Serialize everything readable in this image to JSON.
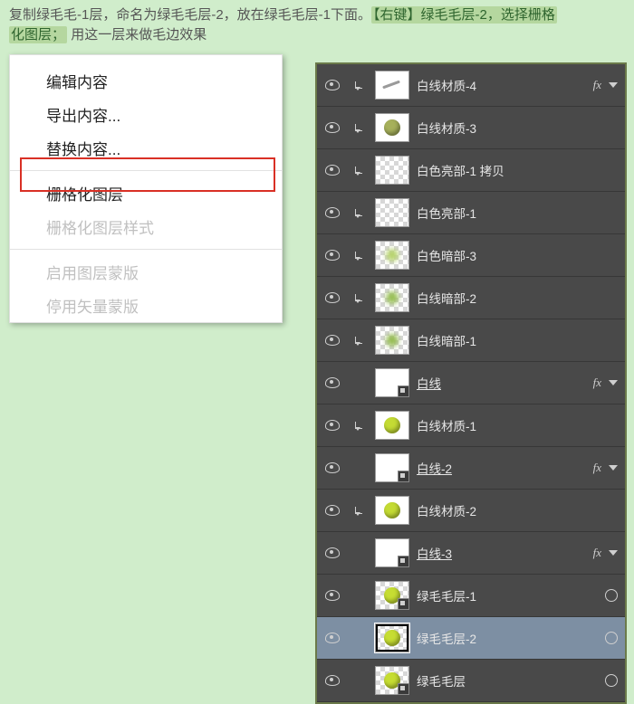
{
  "instruction": {
    "t1": "复制绿毛毛-1层，命名为绿毛毛层-2，放在绿毛毛层-1下面。",
    "t2": "【右键】绿毛毛层-2，选择栅格",
    "t3": "化图层；",
    "t4": "用这一层来做毛边效果"
  },
  "context_menu": {
    "items": [
      {
        "label": "编辑内容",
        "enabled": true
      },
      {
        "label": "导出内容...",
        "enabled": true
      },
      {
        "label": "替换内容...",
        "enabled": true
      },
      {
        "sep": true
      },
      {
        "label": "栅格化图层",
        "enabled": true,
        "highlighted": true
      },
      {
        "label": "栅格化图层样式",
        "enabled": false
      },
      {
        "sep": true
      },
      {
        "label": "启用图层蒙版",
        "enabled": false
      },
      {
        "label": "停用矢量蒙版",
        "enabled": false
      }
    ]
  },
  "layers": [
    {
      "name": "白线材质-4",
      "nested": true,
      "thumb": "white-line",
      "fx": true,
      "chev": true
    },
    {
      "name": "白线材质-3",
      "nested": true,
      "thumb": "ball",
      "ball_color": "#a6b05b"
    },
    {
      "name": "白色亮部-1 拷贝",
      "nested": true,
      "thumb": "checker"
    },
    {
      "name": "白色亮部-1",
      "nested": true,
      "thumb": "checker"
    },
    {
      "name": "白色暗部-3",
      "nested": true,
      "thumb": "blur",
      "blur_color": "#b8d46f"
    },
    {
      "name": "白线暗部-2",
      "nested": true,
      "thumb": "blur",
      "blur_color": "#99c056"
    },
    {
      "name": "白线暗部-1",
      "nested": true,
      "thumb": "blur",
      "blur_color": "#97bd55"
    },
    {
      "name": "白线",
      "nested": false,
      "thumb": "white",
      "smart": true,
      "underline": true,
      "fx": true,
      "chev": true
    },
    {
      "name": "白线材质-1",
      "nested": true,
      "thumb": "ball",
      "ball_color": "#c4db34"
    },
    {
      "name": "白线-2",
      "nested": false,
      "thumb": "white",
      "smart": true,
      "underline": true,
      "fx": true,
      "chev": true
    },
    {
      "name": "白线材质-2",
      "nested": true,
      "thumb": "ball",
      "ball_color": "#c4db34"
    },
    {
      "name": "白线-3",
      "nested": false,
      "thumb": "white",
      "smart": true,
      "underline": true,
      "fx": true,
      "chev": true
    },
    {
      "name": "绿毛毛层-1",
      "nested": false,
      "thumb": "ball",
      "ball_color": "#c6dd32",
      "smart": true,
      "checker_bg": true,
      "circ": true
    },
    {
      "name": "绿毛毛层-2",
      "nested": false,
      "thumb": "ball",
      "ball_color": "#c6dd32",
      "checker_bg": true,
      "circ": true,
      "selected": true,
      "thumb_sel": true
    },
    {
      "name": "绿毛毛层",
      "nested": false,
      "thumb": "ball",
      "ball_color": "#c6dd32",
      "smart": true,
      "checker_bg": true,
      "circ": true
    }
  ],
  "fx_label": "fx"
}
